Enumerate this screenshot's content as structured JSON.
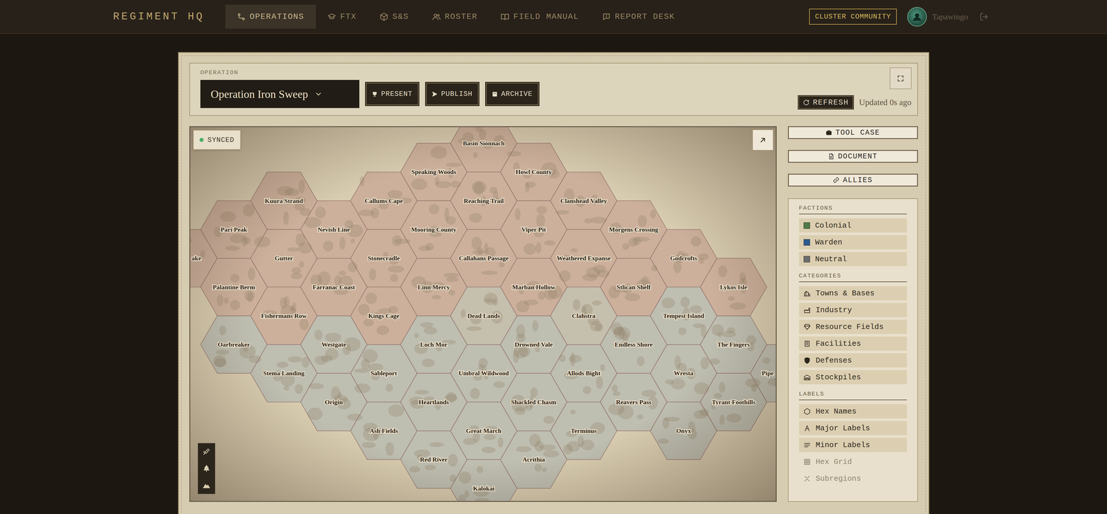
{
  "nav": {
    "logo": "REGIMENT HQ",
    "items": [
      {
        "label": "OPERATIONS",
        "selected": true
      },
      {
        "label": "FTX",
        "selected": false
      },
      {
        "label": "S&S",
        "selected": false
      },
      {
        "label": "ROSTER",
        "selected": false
      },
      {
        "label": "FIELD MANUAL",
        "selected": false
      },
      {
        "label": "REPORT DESK",
        "selected": false
      }
    ],
    "community_button": "CLUSTER COMMUNITY",
    "user": {
      "name": "Tapawingo"
    }
  },
  "operation": {
    "label": "OPERATION",
    "selected": "Operation Iron Sweep",
    "actions": [
      "PRESENT",
      "PUBLISH",
      "ARCHIVE"
    ],
    "refresh": "REFRESH",
    "updated": "Updated 0s ago"
  },
  "map": {
    "status": {
      "label": "SYNCED",
      "synced": true
    },
    "hexes": [
      {
        "name": "Basin Sionnach",
        "color": "#c49c90"
      },
      {
        "name": "Speaking Woods",
        "color": "#c49c90"
      },
      {
        "name": "Howl County",
        "color": "#c49c90"
      },
      {
        "name": "Kuura Strand",
        "color": "#c49c90"
      },
      {
        "name": "Callums Cape",
        "color": "#c49c90"
      },
      {
        "name": "Reaching Trail",
        "color": "#c49c90"
      },
      {
        "name": "Clanshead Valley",
        "color": "#c49c90"
      },
      {
        "name": "Pari Peak",
        "color": "#c49c90"
      },
      {
        "name": "Nevish Line",
        "color": "#c49c90"
      },
      {
        "name": "Mooring County",
        "color": "#c49c90"
      },
      {
        "name": "Viper Pit",
        "color": "#c49c90"
      },
      {
        "name": "Morgens Crossing",
        "color": "#c49c90"
      },
      {
        "name": "ake",
        "color": "#c49c90"
      },
      {
        "name": "Gutter",
        "color": "#c49c90"
      },
      {
        "name": "Stonecradle",
        "color": "#c49c90"
      },
      {
        "name": "Callahans Passage",
        "color": "#c49c90"
      },
      {
        "name": "Weathered Expanse",
        "color": "#c49c90"
      },
      {
        "name": "Godcrofts",
        "color": "#c49c90"
      },
      {
        "name": "Palantine Berm",
        "color": "#c49c90"
      },
      {
        "name": "Farranac Coast",
        "color": "#c49c90"
      },
      {
        "name": "Linn Mercy",
        "color": "#c49c90"
      },
      {
        "name": "Marban Hollow",
        "color": "#c49c90"
      },
      {
        "name": "Stlican Shelf",
        "color": "#c49c90"
      },
      {
        "name": "Lykos Isle",
        "color": "#c49c90"
      },
      {
        "name": "Fishermans Row",
        "color": "#c49c90"
      },
      {
        "name": "Kings Cage",
        "color": "#c49c90"
      },
      {
        "name": "Dead Lands",
        "color": "#b9b6ae"
      },
      {
        "name": "Clahstra",
        "color": "#b9b6ae"
      },
      {
        "name": "Tempest Island",
        "color": "#aeb4b3"
      },
      {
        "name": "Oarbreaker",
        "color": "#aeb4b3"
      },
      {
        "name": "Westgate",
        "color": "#aeb4b3"
      },
      {
        "name": "Loch Mor",
        "color": "#aeb4b3"
      },
      {
        "name": "Drowned Vale",
        "color": "#aeb4b3"
      },
      {
        "name": "Endless Shore",
        "color": "#aeb4b3"
      },
      {
        "name": "The Fingers",
        "color": "#aeb4b3"
      },
      {
        "name": "Stema Landing",
        "color": "#aeb4b3"
      },
      {
        "name": "Sableport",
        "color": "#aeb4b3"
      },
      {
        "name": "Umbral Wildwood",
        "color": "#aeb4b3"
      },
      {
        "name": "Allods Bight",
        "color": "#aeb4b3"
      },
      {
        "name": "Wresta",
        "color": "#aeb4b3"
      },
      {
        "name": "Pipe",
        "color": "#aeb4b3"
      },
      {
        "name": "Origin",
        "color": "#aeb4b3"
      },
      {
        "name": "Heartlands",
        "color": "#aeb4b3"
      },
      {
        "name": "Shackled Chasm",
        "color": "#aeb4b3"
      },
      {
        "name": "Reavers Pass",
        "color": "#aeb4b3"
      },
      {
        "name": "Tyrant Foothills",
        "color": "#aeb4b3"
      },
      {
        "name": "Ash Fields",
        "color": "#aeb4b3"
      },
      {
        "name": "Great March",
        "color": "#aeb4b3"
      },
      {
        "name": "Terminus",
        "color": "#aeb4b3"
      },
      {
        "name": "Onyx",
        "color": "#aeb4b3"
      },
      {
        "name": "Red River",
        "color": "#aeb4b3"
      },
      {
        "name": "Acrithia",
        "color": "#aeb4b3"
      },
      {
        "name": "Kalokai",
        "color": "#aeb4b3"
      }
    ]
  },
  "tools": [
    "TOOL CASE",
    "DOCUMENT",
    "ALLIES"
  ],
  "legend": {
    "sections": [
      {
        "title": "FACTIONS",
        "items": [
          {
            "label": "Colonial",
            "on": true,
            "color": "#4d7a45"
          },
          {
            "label": "Warden",
            "on": true,
            "color": "#2c5a8e"
          },
          {
            "label": "Neutral",
            "on": true,
            "color": "#6b6b6b"
          }
        ]
      },
      {
        "title": "CATEGORIES",
        "items": [
          {
            "label": "Towns & Bases",
            "on": true
          },
          {
            "label": "Industry",
            "on": true
          },
          {
            "label": "Resource Fields",
            "on": true
          },
          {
            "label": "Facilities",
            "on": true
          },
          {
            "label": "Defenses",
            "on": true
          },
          {
            "label": "Stockpiles",
            "on": true
          }
        ]
      },
      {
        "title": "LABELS",
        "items": [
          {
            "label": "Hex Names",
            "on": true
          },
          {
            "label": "Major Labels",
            "on": true
          },
          {
            "label": "Minor Labels",
            "on": true
          },
          {
            "label": "Hex Grid",
            "on": false
          },
          {
            "label": "Subregions",
            "on": false
          }
        ]
      }
    ]
  }
}
